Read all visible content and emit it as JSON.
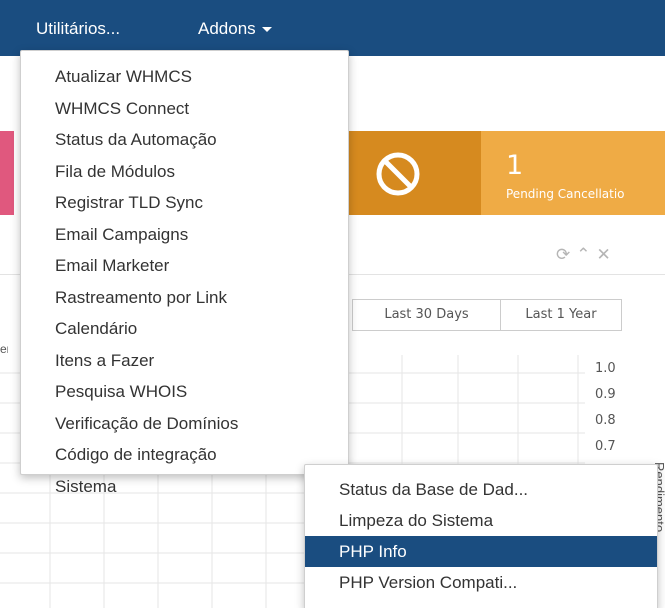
{
  "navbar": {
    "background": "#1a4d80",
    "items": [
      {
        "label": "Utilitários...",
        "open": true
      },
      {
        "label": "Addons",
        "has_caret": true
      }
    ]
  },
  "stats": {
    "pending_cancellations": {
      "value": "1",
      "label": "Pending Cancellatio",
      "icon": "ban-icon",
      "color": "#efab45",
      "icon_bg": "#d68a1f"
    },
    "left_tile_color": "#e0587e"
  },
  "panel": {
    "header_icons": [
      "refresh-icon",
      "chevron-up-icon",
      "close-icon"
    ],
    "range_buttons": [
      "Last 30 Days",
      "Last 1 Year"
    ],
    "left_label_fragment": "er"
  },
  "chart_data": {
    "type": "line",
    "y_ticks": [
      "1.0",
      "0.9",
      "0.8",
      "0.7"
    ],
    "ylabel": "Rendimento",
    "partial_tick": "0.1",
    "grid": true
  },
  "utilities_menu": {
    "items": [
      "Atualizar WHMCS",
      "WHMCS Connect",
      "Status da Automação",
      "Fila de Módulos",
      "Registrar TLD Sync",
      "Email Campaigns",
      "Email Marketer",
      "Rastreamento por Link",
      "Calendário",
      "Itens a Fazer",
      "Pesquisa WHOIS",
      "Verificação de Domínios",
      "Código de integração",
      "Sistema"
    ]
  },
  "system_submenu": {
    "items": [
      "Status da Base de Dad...",
      "Limpeza do Sistema",
      "PHP Info",
      "PHP Version Compati..."
    ],
    "active_index": 2,
    "active_color": "#1a4d80"
  }
}
